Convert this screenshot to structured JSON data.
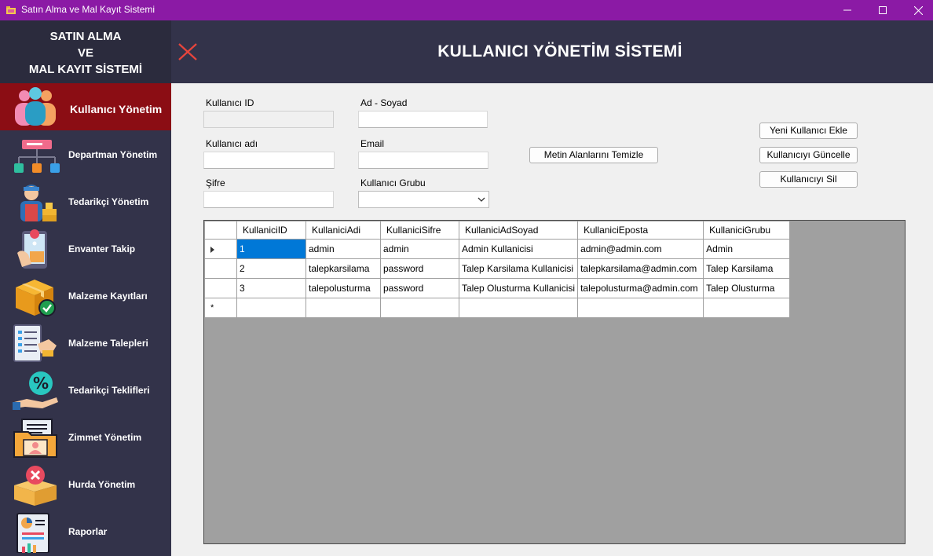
{
  "window": {
    "title": "Satın Alma ve Mal Kayıt Sistemi",
    "titlebar_color": "#8b1aa5"
  },
  "sidebar": {
    "brand_lines": [
      "SATIN ALMA",
      "VE",
      "MAL KAYIT SİSTEMİ"
    ],
    "items": [
      {
        "label": "Kullanıcı Yönetim",
        "icon": "users-icon",
        "active": true
      },
      {
        "label": "Departman Yönetim",
        "icon": "org-chart-icon"
      },
      {
        "label": "Tedarikçi Yönetim",
        "icon": "supplier-icon"
      },
      {
        "label": "Envanter Takip",
        "icon": "phone-location-icon"
      },
      {
        "label": "Malzeme Kayıtları",
        "icon": "box-check-icon"
      },
      {
        "label": "Malzeme Talepleri",
        "icon": "list-request-icon"
      },
      {
        "label": "Tedarikçi Teklifleri",
        "icon": "percent-offer-icon"
      },
      {
        "label": "Zimmet Yönetim",
        "icon": "folder-user-icon"
      },
      {
        "label": "Hurda Yönetim",
        "icon": "box-delete-icon"
      },
      {
        "label": "Raporlar",
        "icon": "report-chart-icon"
      }
    ],
    "active_color": "#8b0d14",
    "background": "#33334a"
  },
  "header": {
    "title": "KULLANICI YÖNETİM SİSTEMİ"
  },
  "form": {
    "user_id_label": "Kullanıcı ID",
    "user_id_value": "",
    "fullname_label": "Ad - Soyad",
    "fullname_value": "",
    "username_label": "Kullanıcı adı",
    "username_value": "",
    "email_label": "Email",
    "email_value": "",
    "password_label": "Şifre",
    "password_value": "",
    "group_label": "Kullanıcı Grubu",
    "group_value": ""
  },
  "buttons": {
    "clear": "Metin Alanlarını Temizle",
    "add": "Yeni Kullanıcı Ekle",
    "update": "Kullanıcıyı Güncelle",
    "delete": "Kullanıcıyı Sil"
  },
  "grid": {
    "columns": [
      "KullaniciID",
      "KullaniciAdi",
      "KullaniciSifre",
      "KullaniciAdSoyad",
      "KullaniciEposta",
      "KullaniciGrubu"
    ],
    "rows": [
      [
        "1",
        "admin",
        "admin",
        "Admin Kullanicisi",
        "admin@admin.com",
        "Admin"
      ],
      [
        "2",
        "talepkarsilama",
        "password",
        "Talep Karsilama Kullanicisi",
        "talepkarsilama@admin.com",
        "Talep Karsilama"
      ],
      [
        "3",
        "talepolusturma",
        "password",
        "Talep Olusturma Kullanicisi",
        "talepolusturma@admin.com",
        "Talep Olusturma"
      ]
    ],
    "new_row_marker": "*",
    "selected_cell_color": "#0078d7"
  }
}
